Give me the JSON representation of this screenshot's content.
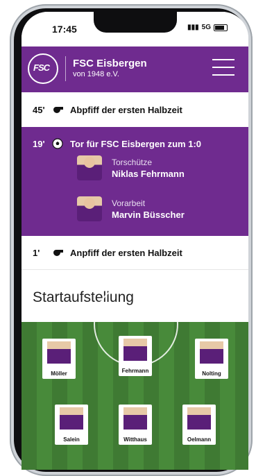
{
  "status": {
    "time": "17:45",
    "network": "5G"
  },
  "header": {
    "name": "FSC Eisbergen",
    "sub": "von 1948 e.V.",
    "logo_text": "FSC"
  },
  "events": [
    {
      "minute": "45'",
      "text": "Abpfiff der ersten Halbzeit",
      "icon": "whistle-icon"
    },
    {
      "minute": "19'",
      "text": "Tor für FSC Eisbergen zum 1:0",
      "icon": "soccer-ball-icon",
      "scorer": {
        "role": "Torschütze",
        "name": "Niklas Fehrmann"
      },
      "assist": {
        "role": "Vorarbeit",
        "name": "Marvin Büsscher"
      }
    },
    {
      "minute": "1'",
      "text": "Anpfiff der ersten Halbzeit",
      "icon": "whistle-icon"
    }
  ],
  "lineup": {
    "title": "Startaufstellung",
    "players": [
      "Möller",
      "Fehrmann",
      "Nolting",
      "Salein",
      "Witthaus",
      "Oelmann"
    ]
  },
  "colors": {
    "brand": "#6f2b8f",
    "pitch": "#488a3a"
  }
}
